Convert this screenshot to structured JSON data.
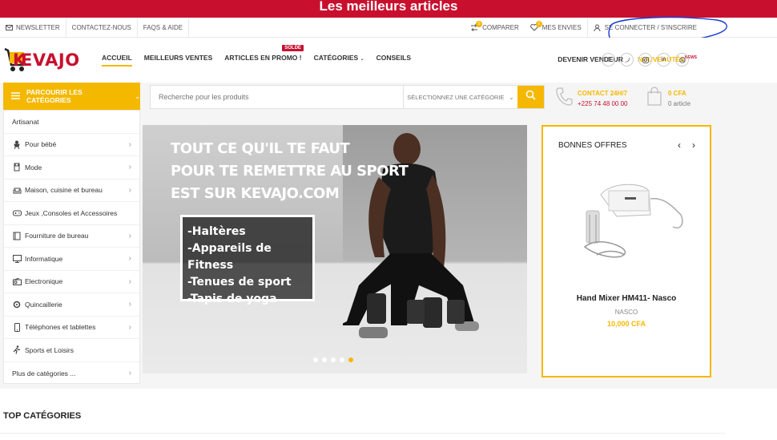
{
  "promo": {
    "text": "Les meilleurs articles"
  },
  "topbar": {
    "left": [
      {
        "label": "Newsletter",
        "icon": "mail-icon"
      },
      {
        "label": "Contactez-nous",
        "icon": ""
      },
      {
        "label": "FAQs & Aide",
        "icon": ""
      }
    ],
    "compare": {
      "label": "Comparer",
      "count": "0"
    },
    "wishlist": {
      "label": "Mes envies",
      "count": "0"
    },
    "account": {
      "label": "Se connecter / S'inscrire"
    }
  },
  "logo": {
    "text": "EVAJO",
    "letter": "K"
  },
  "nav": {
    "items": [
      "Accueil",
      "Meilleurs ventes",
      "Articles en promo !",
      "Catégories",
      "Conseils"
    ],
    "solde_badge": "Solde"
  },
  "header_right": {
    "vendor": "Devenir vendeur",
    "news": "Nouveautés",
    "news_tag": "news"
  },
  "search": {
    "placeholder": "Recherche pour les produits",
    "category": "Sélectionnez une catégorie",
    "categories_label": "Parcourir les catégories"
  },
  "contact": {
    "label": "Contact 24h/7",
    "phone": "+225 74 48 00 00"
  },
  "cart": {
    "total": "0 CFA",
    "count": "0 article"
  },
  "sidebar": {
    "items": [
      {
        "label": "Artisanat",
        "icon": ""
      },
      {
        "label": "Pour bébé",
        "icon": "baby-icon"
      },
      {
        "label": "Mode",
        "icon": "shirt-icon"
      },
      {
        "label": "Maison, cuisine et bureau",
        "icon": "sofa-icon"
      },
      {
        "label": "Jeux ,Consoles et Accessoires",
        "icon": "gamepad-icon"
      },
      {
        "label": "Fourniture de bureau",
        "icon": "notepad-icon"
      },
      {
        "label": "Informatique",
        "icon": "monitor-icon"
      },
      {
        "label": "Electronique",
        "icon": "radio-icon"
      },
      {
        "label": "Quincaillerie",
        "icon": "tools-icon"
      },
      {
        "label": "Téléphones et tablettes",
        "icon": "phone-icon"
      },
      {
        "label": "Sports et Loisirs",
        "icon": "running-icon"
      },
      {
        "label": "Plus de catégories ...",
        "icon": ""
      }
    ]
  },
  "banner": {
    "headline": [
      "TOUT CE QU'IL TE FAUT",
      "POUR TE REMETTRE AU SPORT",
      "EST SUR KEVAJO.COM"
    ],
    "list": [
      "-Haltères",
      "-Appareils de Fitness",
      "-Tenues de sport",
      "-Tapis de yoga"
    ],
    "slides": 5,
    "active_slide": 5
  },
  "deals": {
    "title": "Bonnes offres",
    "product": {
      "name": "Hand Mixer HM411- Nasco",
      "brand": "NASCO",
      "price": "10,000 CFA"
    }
  },
  "top_categories": {
    "title": "Top catégories"
  },
  "colors": {
    "accent": "#f5b800",
    "brand_red": "#c8102e",
    "annotation": "#1a3bd6"
  }
}
